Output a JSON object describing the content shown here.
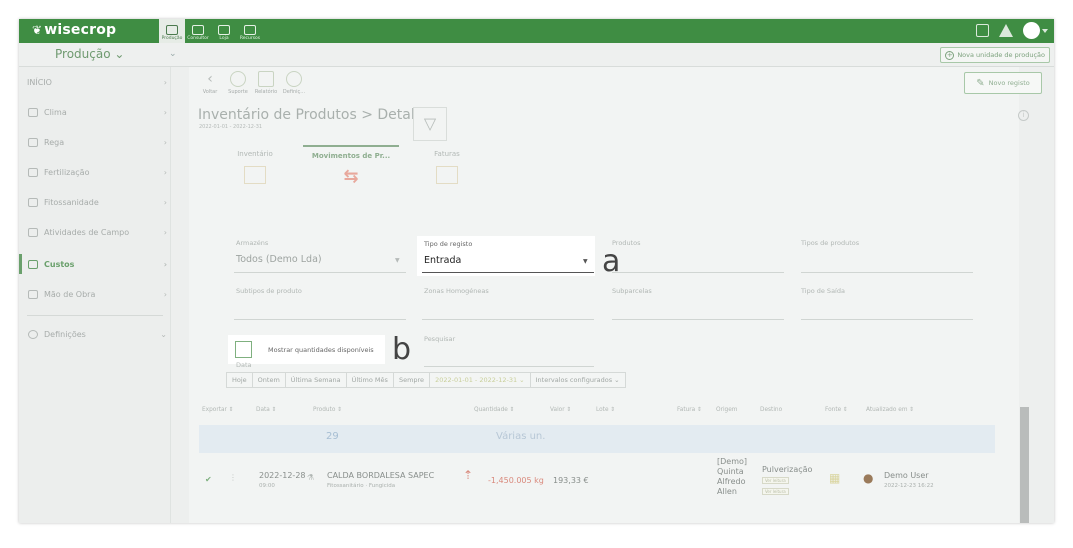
{
  "app": {
    "brand": "wisecrop",
    "top_nav": [
      "Produção",
      "Consultor",
      "Loja",
      "Recursos"
    ],
    "area_selector": "Produção ⌄",
    "area_selector2": "⌄",
    "new_unit_button": "Nova unidade de produção"
  },
  "sidebar": {
    "items": [
      {
        "label": "INÍCIO"
      },
      {
        "label": "Clima"
      },
      {
        "label": "Rega"
      },
      {
        "label": "Fertilização"
      },
      {
        "label": "Fitossanidade"
      },
      {
        "label": "Atividades de Campo"
      },
      {
        "label": "Custos"
      },
      {
        "label": "Mão de Obra"
      },
      {
        "label": "Definições"
      }
    ]
  },
  "toolbar": {
    "back": "Voltar",
    "support": "Suporte",
    "report": "Relatório",
    "settings": "Definiç...",
    "new_record": "Novo registo"
  },
  "page": {
    "title": "Inventário de Produtos  >  Detalhes",
    "subtitle": "2022-01-01 - 2022-12-31"
  },
  "tabs": [
    "Inventário",
    "Movimentos de Pr...",
    "Faturas"
  ],
  "filters": {
    "armazens_label": "Armazéns",
    "armazens_value": "Todos (Demo Lda)",
    "tipo_registo_label": "Tipo de registo",
    "tipo_registo_value": "Entrada",
    "produtos_label": "Produtos",
    "tipos_produtos_label": "Tipos de produtos",
    "subtipos_label": "Subtipos de produto",
    "zonas_label": "Zonas Homogéneas",
    "subparcelas_label": "Subparcelas",
    "tipo_saida_label": "Tipo de Saída",
    "mostrar_label": "Mostrar quantidades disponíveis",
    "pesquisar_label": "Pesquisar"
  },
  "annotations": {
    "a": "a",
    "b": "b"
  },
  "date": {
    "label": "Data",
    "buttons": [
      "Hoje",
      "Ontem",
      "Última Semana",
      "Último Mês",
      "Sempre",
      "2022-01-01 - 2022-12-31 ⌄",
      "Intervalos configurados ⌄"
    ]
  },
  "table": {
    "headers": [
      "Exportar ⇕",
      "Data ⇕",
      "Produto ⇕",
      "Quantidade ⇕",
      "Valor ⇕",
      "Lote ⇕",
      "Fatura ⇕",
      "Origem",
      "Destino",
      "Fonte ⇕",
      "Atualizado em ⇕"
    ],
    "summary": {
      "count": "29",
      "quantity": "Várias un."
    },
    "row": {
      "date": "2022-12-28",
      "time": "09:00",
      "product": "CALDA BORDALESA SAPEC",
      "product_type": "Fitossanitário · Fungicida",
      "quantity": "-1,450.005 kg",
      "value": "193,33 €",
      "origin": "[Demo]\nQuinta\nAlfredo\nAllen",
      "destination": "Pulverização",
      "badge1": "Ver leitura",
      "badge2": "Ver leitura",
      "user": "Demo User",
      "updated": "2022-12-23 16:22"
    }
  }
}
